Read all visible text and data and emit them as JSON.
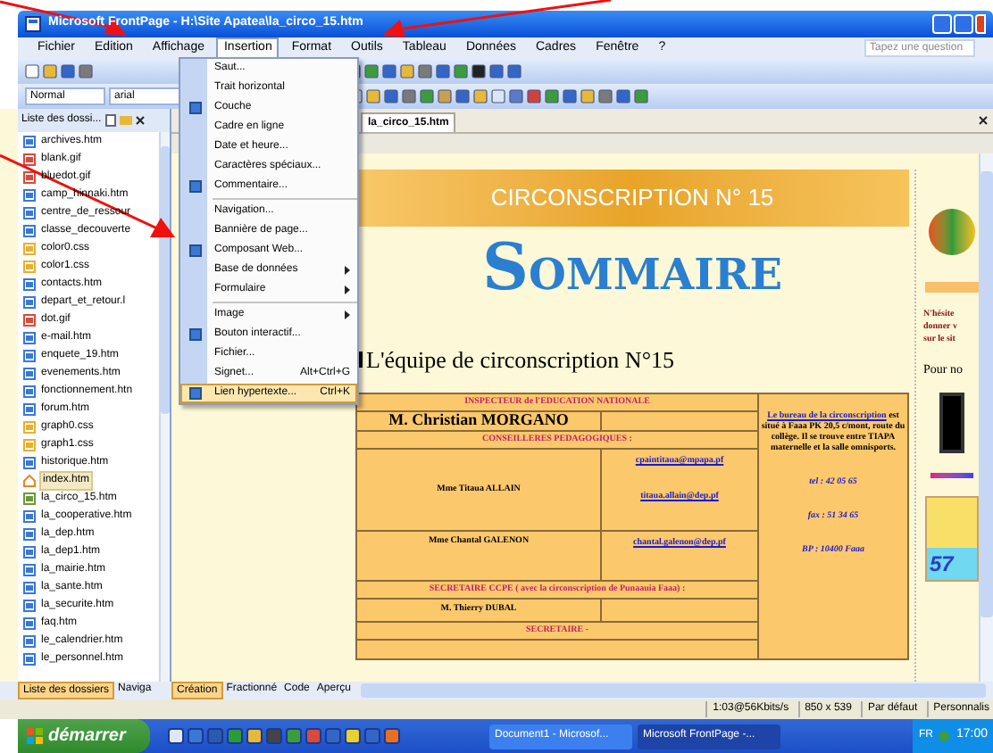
{
  "window": {
    "title": "Microsoft FrontPage - H:\\Site Apatea\\la_circo_15.htm"
  },
  "menu_bar": {
    "items": [
      {
        "label": "Fichier",
        "selected": false
      },
      {
        "label": "Edition",
        "selected": false
      },
      {
        "label": "Affichage",
        "selected": false
      },
      {
        "label": "Insertion",
        "selected": true
      },
      {
        "label": "Format",
        "selected": false
      },
      {
        "label": "Outils",
        "selected": false
      },
      {
        "label": "Tableau",
        "selected": false
      },
      {
        "label": "Données",
        "selected": false
      },
      {
        "label": "Cadres",
        "selected": false
      },
      {
        "label": "Fenêtre",
        "selected": false
      },
      {
        "label": "?",
        "selected": false
      }
    ],
    "help_placeholder": "Tapez une question"
  },
  "format_toolbar": {
    "style": "Normal",
    "font": "arial"
  },
  "insert_menu": [
    {
      "label": "Saut...",
      "separator_before": false
    },
    {
      "label": "Trait horizontal",
      "separator_before": false
    },
    {
      "label": "Couche",
      "separator_before": false,
      "icon": true
    },
    {
      "label": "Cadre en ligne",
      "separator_before": false
    },
    {
      "label": "Date et heure...",
      "separator_before": false
    },
    {
      "label": "Caractères spéciaux...",
      "separator_before": false
    },
    {
      "label": "Commentaire...",
      "separator_before": false,
      "icon": true
    },
    {
      "label": "Navigation...",
      "separator_before": true
    },
    {
      "label": "Bannière de page...",
      "separator_before": false
    },
    {
      "label": "Composant Web...",
      "separator_before": false,
      "icon": true
    },
    {
      "label": "Base de données",
      "separator_before": false,
      "submenu": true
    },
    {
      "label": "Formulaire",
      "separator_before": false,
      "submenu": true
    },
    {
      "label": "Image",
      "separator_before": true,
      "submenu": true
    },
    {
      "label": "Bouton interactif...",
      "separator_before": false,
      "icon": true
    },
    {
      "label": "Fichier...",
      "separator_before": false
    },
    {
      "label": "Signet...",
      "separator_before": false,
      "shortcut": "Alt+Ctrl+G"
    },
    {
      "label": "Lien hypertexte...",
      "separator_before": false,
      "shortcut": "Ctrl+K",
      "icon": true,
      "selected": true
    }
  ],
  "folder_list": {
    "title": "Liste des dossi...",
    "files": [
      {
        "name": "archives.htm",
        "kind": "page",
        "selected": false
      },
      {
        "name": "blank.gif",
        "kind": "image",
        "selected": false
      },
      {
        "name": "bluedot.gif",
        "kind": "image",
        "selected": false
      },
      {
        "name": "camp_hinnaki.htm",
        "kind": "page",
        "selected": false
      },
      {
        "name": "centre_de_ressour",
        "kind": "page",
        "selected": false
      },
      {
        "name": "classe_decouverte",
        "kind": "page",
        "selected": false
      },
      {
        "name": "color0.css",
        "kind": "css",
        "selected": false
      },
      {
        "name": "color1.css",
        "kind": "css",
        "selected": false
      },
      {
        "name": "contacts.htm",
        "kind": "page",
        "selected": false
      },
      {
        "name": "depart_et_retour.l",
        "kind": "page",
        "selected": false
      },
      {
        "name": "dot.gif",
        "kind": "image",
        "selected": false
      },
      {
        "name": "e-mail.htm",
        "kind": "page",
        "selected": false
      },
      {
        "name": "enquete_19.htm",
        "kind": "page",
        "selected": false
      },
      {
        "name": "evenements.htm",
        "kind": "page",
        "selected": false
      },
      {
        "name": "fonctionnement.htn",
        "kind": "page",
        "selected": false
      },
      {
        "name": "forum.htm",
        "kind": "page",
        "selected": false
      },
      {
        "name": "graph0.css",
        "kind": "css",
        "selected": false
      },
      {
        "name": "graph1.css",
        "kind": "css",
        "selected": false
      },
      {
        "name": "historique.htm",
        "kind": "page",
        "selected": false
      },
      {
        "name": "index.htm",
        "kind": "home",
        "selected": true
      },
      {
        "name": "la_circo_15.htm",
        "kind": "edit",
        "selected": false
      },
      {
        "name": "la_cooperative.htm",
        "kind": "page",
        "selected": false
      },
      {
        "name": "la_dep.htm",
        "kind": "page",
        "selected": false
      },
      {
        "name": "la_dep1.htm",
        "kind": "page",
        "selected": false
      },
      {
        "name": "la_mairie.htm",
        "kind": "page",
        "selected": false
      },
      {
        "name": "la_sante.htm",
        "kind": "page",
        "selected": false
      },
      {
        "name": "la_securite.htm",
        "kind": "page",
        "selected": false
      },
      {
        "name": "faq.htm",
        "kind": "page",
        "selected": false
      },
      {
        "name": "le_calendrier.htm",
        "kind": "page",
        "selected": false
      },
      {
        "name": "le_personnel.htm",
        "kind": "page",
        "selected": false
      }
    ],
    "tabs": [
      {
        "label": "Liste des dossiers",
        "selected": true
      },
      {
        "label": "Naviga",
        "selected": false
      }
    ]
  },
  "document_tab": "la_circo_15.htm",
  "page": {
    "banner": "CIRCONSCRIPTION N° 15",
    "heading": "SOMMAIRE",
    "subheading": "L'équipe de circonscription N°15",
    "table_rows": [
      {
        "kind": "header",
        "text": "INSPECTEUR de l'EDUCATION NATIONALE"
      },
      {
        "kind": "main",
        "name": "M. Christian MORGANO",
        "contacts": []
      },
      {
        "kind": "header",
        "text": "CONSEILLERES PEDAGOGIQUES :"
      },
      {
        "kind": "person",
        "name": "Mme Titaua ALLAIN",
        "contacts": [
          "cpaintitaua@mpapa.pf",
          "titaua.allain@dep.pf"
        ]
      },
      {
        "kind": "person",
        "name": "Mme Chantal GALENON",
        "contacts": [
          "chantal.galenon@dep.pf"
        ]
      },
      {
        "kind": "header",
        "text": "SECRETAIRE CCPE ( avec la circonscription de Punaauia Faaa) :"
      },
      {
        "kind": "person",
        "name": "M. Thierry DUBAL",
        "contacts": []
      },
      {
        "kind": "header",
        "text": "SECRETAIRE -"
      }
    ],
    "office": {
      "link": "Le bureau de la circonscription",
      "text": " est situé à Faaa PK 20,5 c/mont, route du collège. Il se trouve entre TIAPA maternelle et la salle omnisports.",
      "tel": "tel : 42 05 65",
      "fax": "fax : 51 34 65",
      "bp": "BP : 10400 Faaa"
    },
    "side_text": [
      "N'hésite",
      "donner v",
      "sur le sit"
    ],
    "side_note": "Pour no",
    "side_number": "57"
  },
  "view_tabs": [
    {
      "label": "Création",
      "selected": true
    },
    {
      "label": "Fractionné",
      "selected": false
    },
    {
      "label": "Code",
      "selected": false
    },
    {
      "label": "Aperçu",
      "selected": false
    }
  ],
  "status_bar": [
    "1:03@56Kbits/s",
    "850 x 539",
    "Par défaut",
    "Personnalis"
  ],
  "taskbar": {
    "start": "démarrer",
    "tasks": [
      {
        "label": "Document1 - Microsof...",
        "selected": false
      },
      {
        "label": "Microsoft FrontPage -...",
        "selected": true
      }
    ],
    "language": "FR",
    "clock": "17:00"
  }
}
